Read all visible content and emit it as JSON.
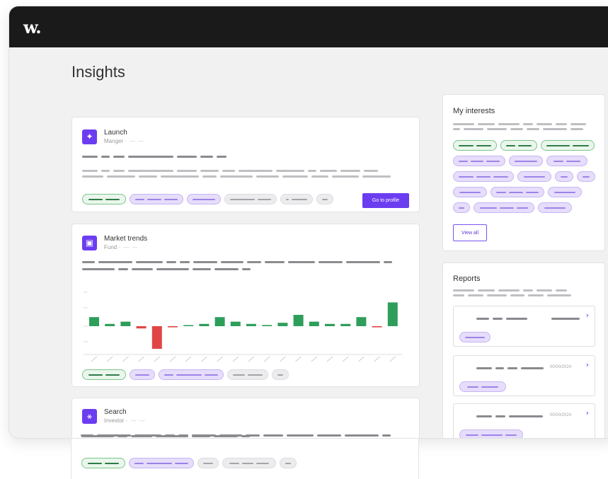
{
  "app": {
    "logo": "w."
  },
  "page": {
    "title": "Insights"
  },
  "cards": {
    "launch": {
      "title": "Launch",
      "subtitle": "Manger",
      "button": "Go to profile"
    },
    "market": {
      "title": "Market trends",
      "subtitle": "Fund"
    },
    "search": {
      "title": "Search",
      "subtitle": "Investor"
    }
  },
  "interests": {
    "title": "My interests",
    "button": "View all"
  },
  "reports": {
    "title": "Reports",
    "items": [
      {
        "date": ""
      },
      {
        "date": "00/00/2024"
      },
      {
        "date": "00/00/2024"
      }
    ]
  },
  "chart_data": {
    "type": "bar",
    "colors": {
      "positive": "#2e9e5b",
      "negative": "#e04646"
    },
    "values": [
      4,
      1,
      2,
      -1,
      -10,
      -0.5,
      0.3,
      1,
      4,
      2,
      1,
      0.5,
      1.5,
      5,
      2,
      1,
      1,
      4,
      -0.5,
      10.5
    ]
  },
  "colors": {
    "accent": "#6b3df0",
    "topbar": "#1a1a1a"
  }
}
